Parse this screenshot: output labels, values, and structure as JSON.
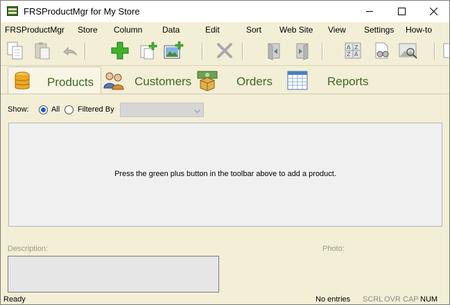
{
  "window": {
    "title": "FRSProductMgr for My Store"
  },
  "menu": [
    "FRSProductMgr",
    "Store",
    "Column",
    "Data",
    "Edit",
    "Sort",
    "Web Site",
    "View",
    "Settings",
    "How-to"
  ],
  "toolbar": {
    "buttons": [
      "copy-icon",
      "paste-icon",
      "undo-icon",
      "add-product-icon",
      "duplicate-icon",
      "add-image-icon",
      "delete-icon",
      "move-up-icon",
      "move-down-icon",
      "sort-az-icon",
      "find-icon",
      "preview-icon"
    ]
  },
  "tabs": [
    {
      "label": "Products",
      "icon": "database-icon",
      "active": true
    },
    {
      "label": "Customers",
      "icon": "customers-icon",
      "active": false
    },
    {
      "label": "Orders",
      "icon": "orders-icon",
      "active": false
    },
    {
      "label": "Reports",
      "icon": "reports-icon",
      "active": false
    }
  ],
  "filter": {
    "show_label": "Show:",
    "all_label": "All",
    "filtered_label": "Filtered By",
    "selected": "all",
    "select_value": ""
  },
  "list": {
    "empty_message": "Press the green plus button in the toolbar above to add a product."
  },
  "detail": {
    "description_label": "Description:",
    "photo_label": "Photo:"
  },
  "status": {
    "ready": "Ready",
    "entries": "No entries",
    "scrl": "SCRL",
    "ovr": "OVR",
    "cap": "CAP",
    "num": "NUM"
  },
  "colors": {
    "background": "#f3eed6",
    "tab_text": "#3d6a1f",
    "radio_accent": "#1c5fc9",
    "list_bg": "#f0f0f0"
  }
}
